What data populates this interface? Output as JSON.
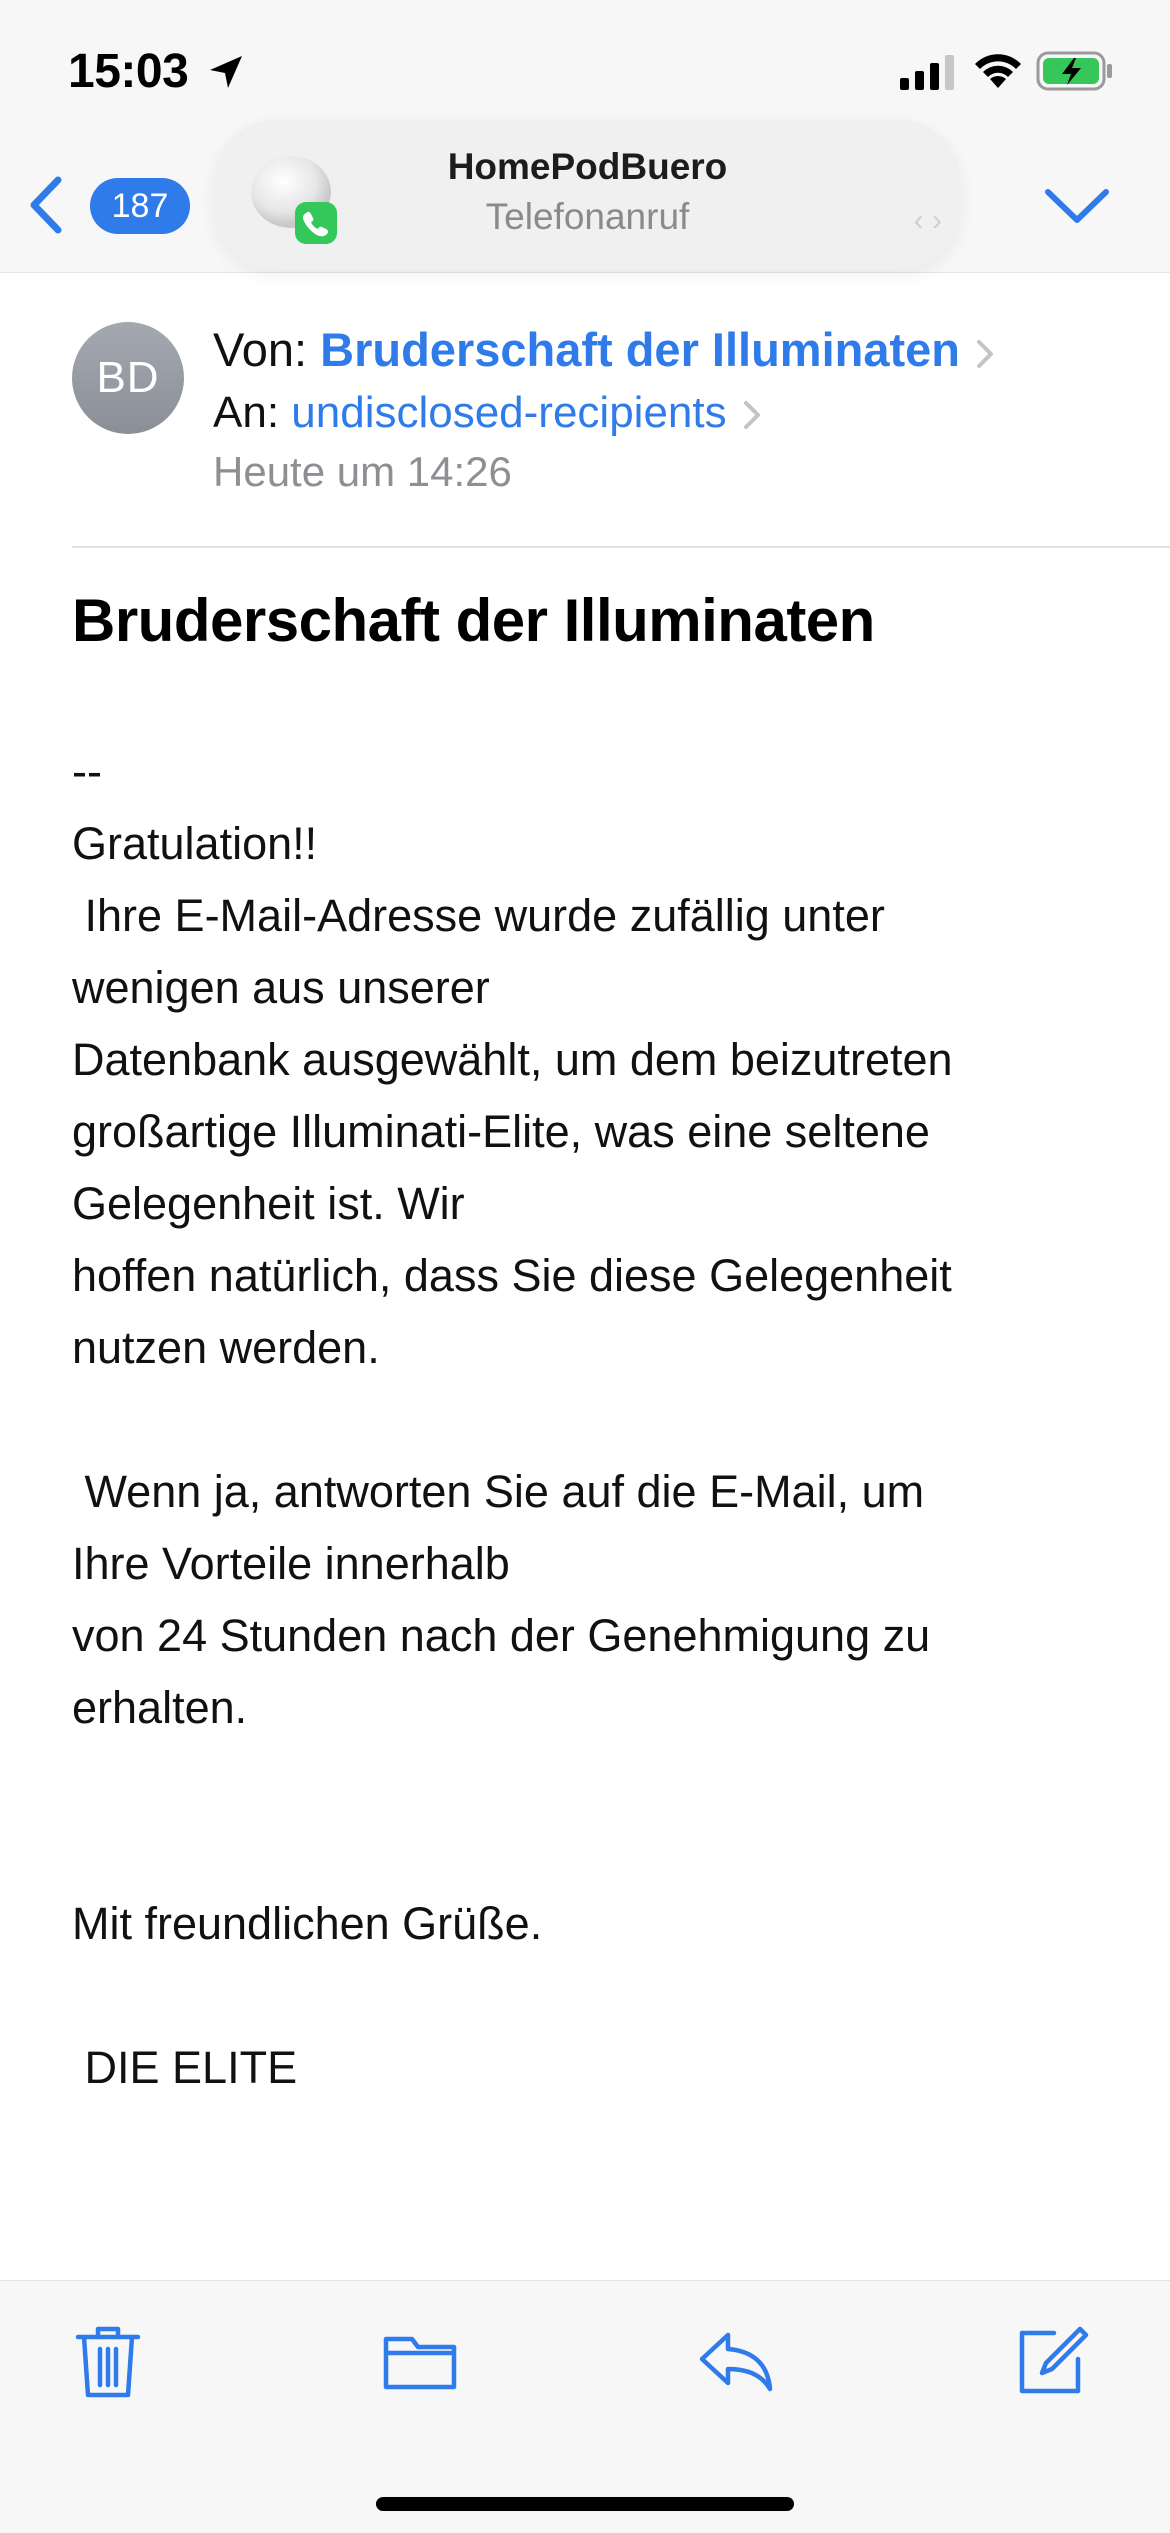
{
  "status_bar": {
    "time": "15:03",
    "icons": [
      "location-arrow-icon",
      "cellular-signal-icon",
      "wifi-icon",
      "battery-charging-icon"
    ]
  },
  "nav": {
    "unread_count": "187",
    "back_icon": "chevron-left-icon",
    "next_icon": "chevron-down-icon"
  },
  "call_banner": {
    "title": "HomePodBuero",
    "subtitle": "Telefonanruf",
    "dots": "‹ ›"
  },
  "message": {
    "avatar_initials": "BD",
    "from_label": "Von:",
    "from_name": "Bruderschaft der Illuminaten",
    "to_label": "An:",
    "to_name": "undisclosed-recipients",
    "date": "Heute um 14:26",
    "subject": "Bruderschaft der Illuminaten",
    "body": "--\nGratulation!!\n Ihre E-Mail-Adresse wurde zufällig unter\nwenigen aus unserer\nDatenbank ausgewählt, um dem beizutreten\ngroßartige Illuminati-Elite, was eine seltene\nGelegenheit ist. Wir\nhoffen natürlich, dass Sie diese Gelegenheit\nnutzen werden.\n\n Wenn ja, antworten Sie auf die E-Mail, um\nIhre Vorteile innerhalb\nvon 24 Stunden nach der Genehmigung zu\nerhalten.\n\n\nMit freundlichen Grüße.\n\n DIE ELITE"
  },
  "toolbar": {
    "icons": [
      "trash-icon",
      "folder-icon",
      "reply-icon",
      "compose-icon"
    ]
  },
  "colors": {
    "accent": "#2f7bea",
    "secondary_text": "#8e8e93",
    "background_bars": "#f7f7f7"
  }
}
